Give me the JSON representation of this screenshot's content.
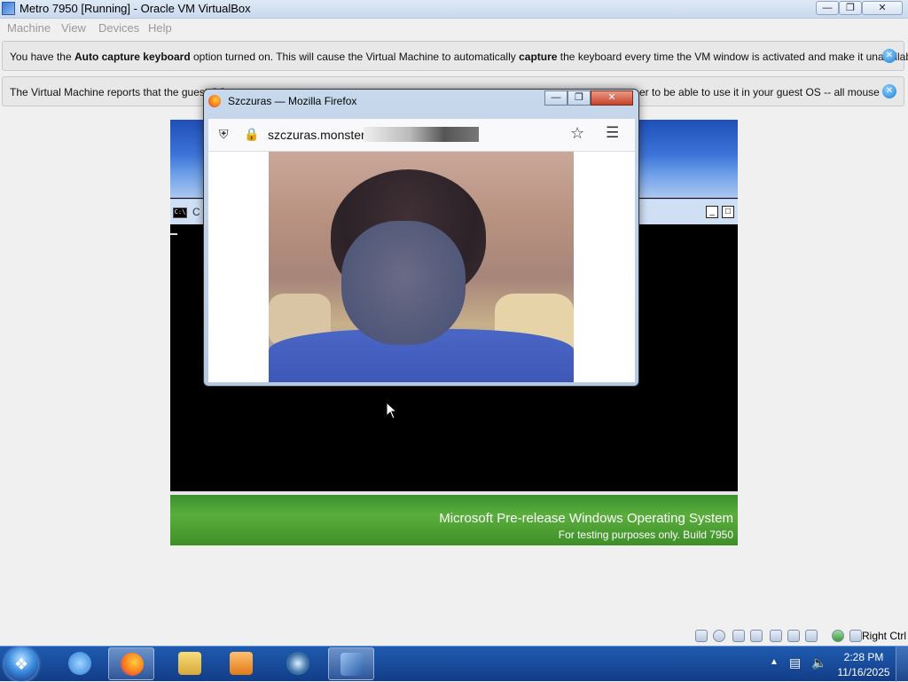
{
  "vbox": {
    "window_title": "Metro 7950 [Running] - Oracle VM VirtualBox",
    "menu": [
      "Machine",
      "View",
      "Devices",
      "Help"
    ],
    "notice1": {
      "parts": [
        "You have the ",
        "Auto capture keyboard",
        " option turned on. This will cause the Virtual Machine to automatically ",
        "capture",
        " the keyboard every time the VM window is activated and make it unavailable to"
      ]
    },
    "notice2": {
      "left_text": "The Virtual Machine reports that the guest OS",
      "right_text": "er to be able to use it in your guest OS -- all mouse"
    },
    "host_key": "Right Ctrl"
  },
  "vm": {
    "cmd_title": "C",
    "os_label": "Microsoft Pre-release Windows Operating System",
    "build_label": "For testing purposes only. Build 7950"
  },
  "firefox": {
    "title": "Szczuras — Mozilla Firefox",
    "url": "szczuras.monster/#"
  },
  "taskbar": {
    "time": "2:28 PM",
    "date": "11/16/2025",
    "apps": [
      {
        "name": "internet-explorer",
        "color": "#2f7fd8"
      },
      {
        "name": "firefox",
        "color": "#ff7a1a",
        "active": true
      },
      {
        "name": "file-explorer",
        "color": "#e8c04a"
      },
      {
        "name": "media-player",
        "color": "#f08a24"
      },
      {
        "name": "ecosystem-app",
        "color": "#3b8f4a"
      },
      {
        "name": "virtualbox",
        "color": "#2a5ca8",
        "active": true
      }
    ]
  }
}
